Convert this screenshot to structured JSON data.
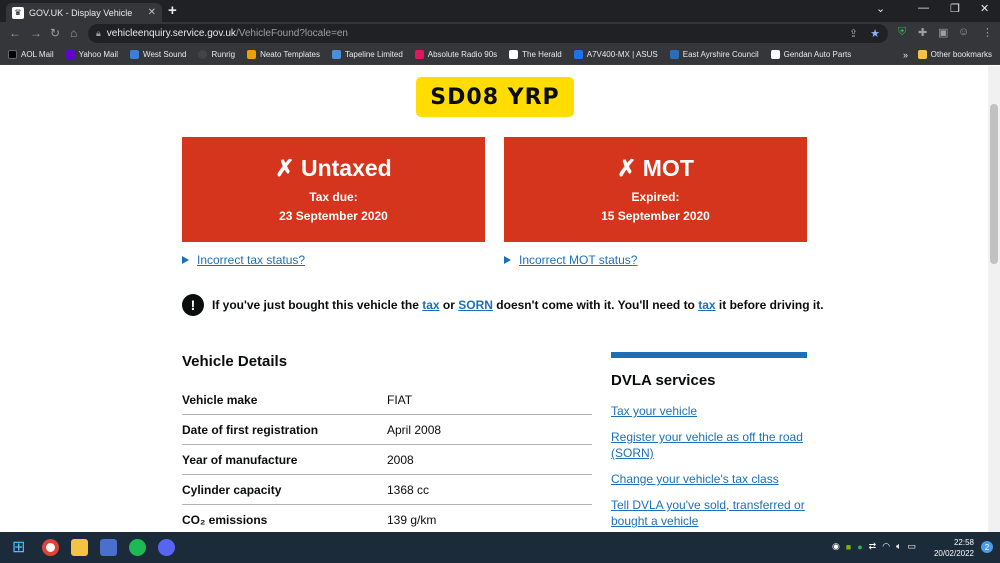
{
  "browser": {
    "tab_title": "GOV.UK - Display Vehicle",
    "url_domain": "vehicleenquiry.service.gov.uk",
    "url_path": "/VehicleFound?locale=en",
    "bookmarks": [
      {
        "label": "AOL Mail",
        "color": "#000000"
      },
      {
        "label": "Yahoo Mail",
        "color": "#6001d2"
      },
      {
        "label": "West Sound",
        "color": "#3b7dd8"
      },
      {
        "label": "Runrig",
        "color": "#444444"
      },
      {
        "label": "Neato Templates",
        "color": "#f39c12"
      },
      {
        "label": "Tapeline Limited",
        "color": "#4a90d9"
      },
      {
        "label": "Absolute Radio 90s",
        "color": "#d81b60"
      },
      {
        "label": "The Herald",
        "color": "#ffffff"
      },
      {
        "label": "A7V400-MX | ASUS",
        "color": "#1a73e8"
      },
      {
        "label": "East Ayrshire Council",
        "color": "#2a6ebb"
      },
      {
        "label": "Gendan Auto Parts",
        "color": "#ffffff"
      }
    ],
    "other_bookmarks": "Other bookmarks"
  },
  "vehicle": {
    "registration": "SD08 YRP"
  },
  "tax_status": {
    "title": "✗ Untaxed",
    "label": "Tax due:",
    "date": "23 September 2020",
    "link": "Incorrect tax status?"
  },
  "mot_status": {
    "title": "✗ MOT",
    "label": "Expired:",
    "date": "15 September 2020",
    "link": "Incorrect MOT status?"
  },
  "warning": {
    "icon": "!",
    "text1": "If you've just bought this vehicle the",
    "tax_link": "tax",
    "or": "or",
    "sorn_link": "SORN",
    "text2": "doesn't come with it. You'll need to",
    "tax_link2": "tax",
    "text3": "it before driving it."
  },
  "vehicle_details": {
    "heading": "Vehicle Details",
    "rows": [
      {
        "key": "Vehicle make",
        "value": "FIAT"
      },
      {
        "key": "Date of first registration",
        "value": "April 2008"
      },
      {
        "key": "Year of manufacture",
        "value": "2008"
      },
      {
        "key": "Cylinder capacity",
        "value": "1368 cc"
      },
      {
        "key": "CO₂ emissions",
        "value": "139 g/km"
      }
    ]
  },
  "dvla_services": {
    "heading": "DVLA services",
    "links": [
      "Tax your vehicle",
      "Register your vehicle as off the road (SORN)",
      "Change your vehicle's tax class",
      "Tell DVLA you've sold, transferred or bought a vehicle"
    ]
  },
  "taskbar": {
    "time": "22:58",
    "date": "20/02/2022",
    "notifications": "2"
  },
  "colors": {
    "error_red": "#d4351c",
    "link_blue": "#1d70b8",
    "plate_yellow": "#ffdd00"
  }
}
